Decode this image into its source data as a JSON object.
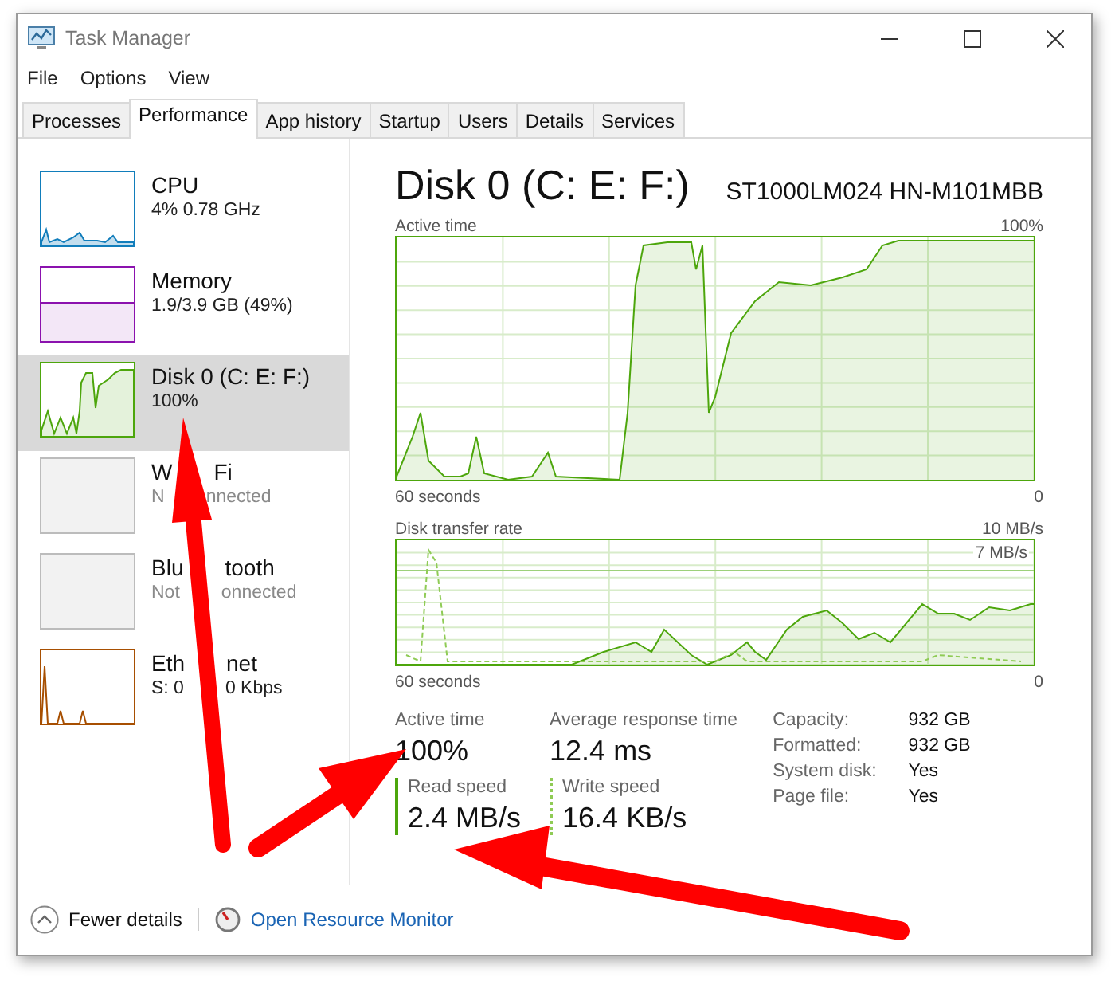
{
  "window": {
    "title": "Task Manager"
  },
  "menu": [
    "File",
    "Options",
    "View"
  ],
  "tabs": [
    {
      "label": "Processes",
      "selected": false
    },
    {
      "label": "Performance",
      "selected": true
    },
    {
      "label": "App history",
      "selected": false
    },
    {
      "label": "Startup",
      "selected": false
    },
    {
      "label": "Users",
      "selected": false
    },
    {
      "label": "Details",
      "selected": false
    },
    {
      "label": "Services",
      "selected": false
    }
  ],
  "sidebar": {
    "items": [
      {
        "kind": "cpu",
        "name": [
          "CPU"
        ],
        "detail": [
          "4% 0.78 GHz"
        ],
        "color": "#117dbb",
        "selected": false,
        "disabled": false
      },
      {
        "kind": "memory",
        "name": [
          "Memory"
        ],
        "detail": [
          "1.9/3.9 GB (49%)"
        ],
        "color": "#8b12ae",
        "selected": false,
        "disabled": false
      },
      {
        "kind": "disk",
        "name": [
          "Disk 0 (C: E: F:)"
        ],
        "detail": [
          "100%"
        ],
        "color": "#4da60c",
        "selected": true,
        "disabled": false
      },
      {
        "kind": "empty",
        "name": [
          "W",
          "Fi"
        ],
        "detail": [
          "N",
          "nnected"
        ],
        "color": "#bcbcbc",
        "selected": false,
        "disabled": true
      },
      {
        "kind": "empty",
        "name": [
          "Blu",
          "tooth"
        ],
        "detail": [
          "Not",
          "onnected"
        ],
        "color": "#bcbcbc",
        "selected": false,
        "disabled": true
      },
      {
        "kind": "ethernet",
        "name": [
          "Eth",
          "net"
        ],
        "detail": [
          "S: 0",
          "0 Kbps"
        ],
        "color": "#a74f01",
        "selected": false,
        "disabled": false
      }
    ]
  },
  "main": {
    "title": "Disk 0 (C: E: F:)",
    "model": "ST1000LM024 HN-M101MBB",
    "active_graph": {
      "label": "Active time",
      "max": "100%",
      "span": "60 seconds",
      "min": "0"
    },
    "transfer_graph": {
      "label": "Disk transfer rate",
      "max": "10 MB/s",
      "scale": "7 MB/s",
      "span": "60 seconds",
      "min": "0"
    },
    "stats": [
      {
        "kind": "plain",
        "label": "Active time",
        "value": "100%"
      },
      {
        "kind": "plain",
        "label": "Average response time",
        "value": "12.4 ms"
      },
      {
        "kind": "solid",
        "label": "Read speed",
        "value": "2.4 MB/s"
      },
      {
        "kind": "dotted",
        "label": "Write speed",
        "value": "16.4 KB/s"
      }
    ],
    "properties": [
      {
        "label": "Capacity:",
        "value": "932 GB"
      },
      {
        "label": "Formatted:",
        "value": "932 GB"
      },
      {
        "label": "System disk:",
        "value": "Yes"
      },
      {
        "label": "Page file:",
        "value": "Yes"
      }
    ]
  },
  "footer": {
    "fewer_details": "Fewer details",
    "link": "Open Resource Monitor"
  }
}
